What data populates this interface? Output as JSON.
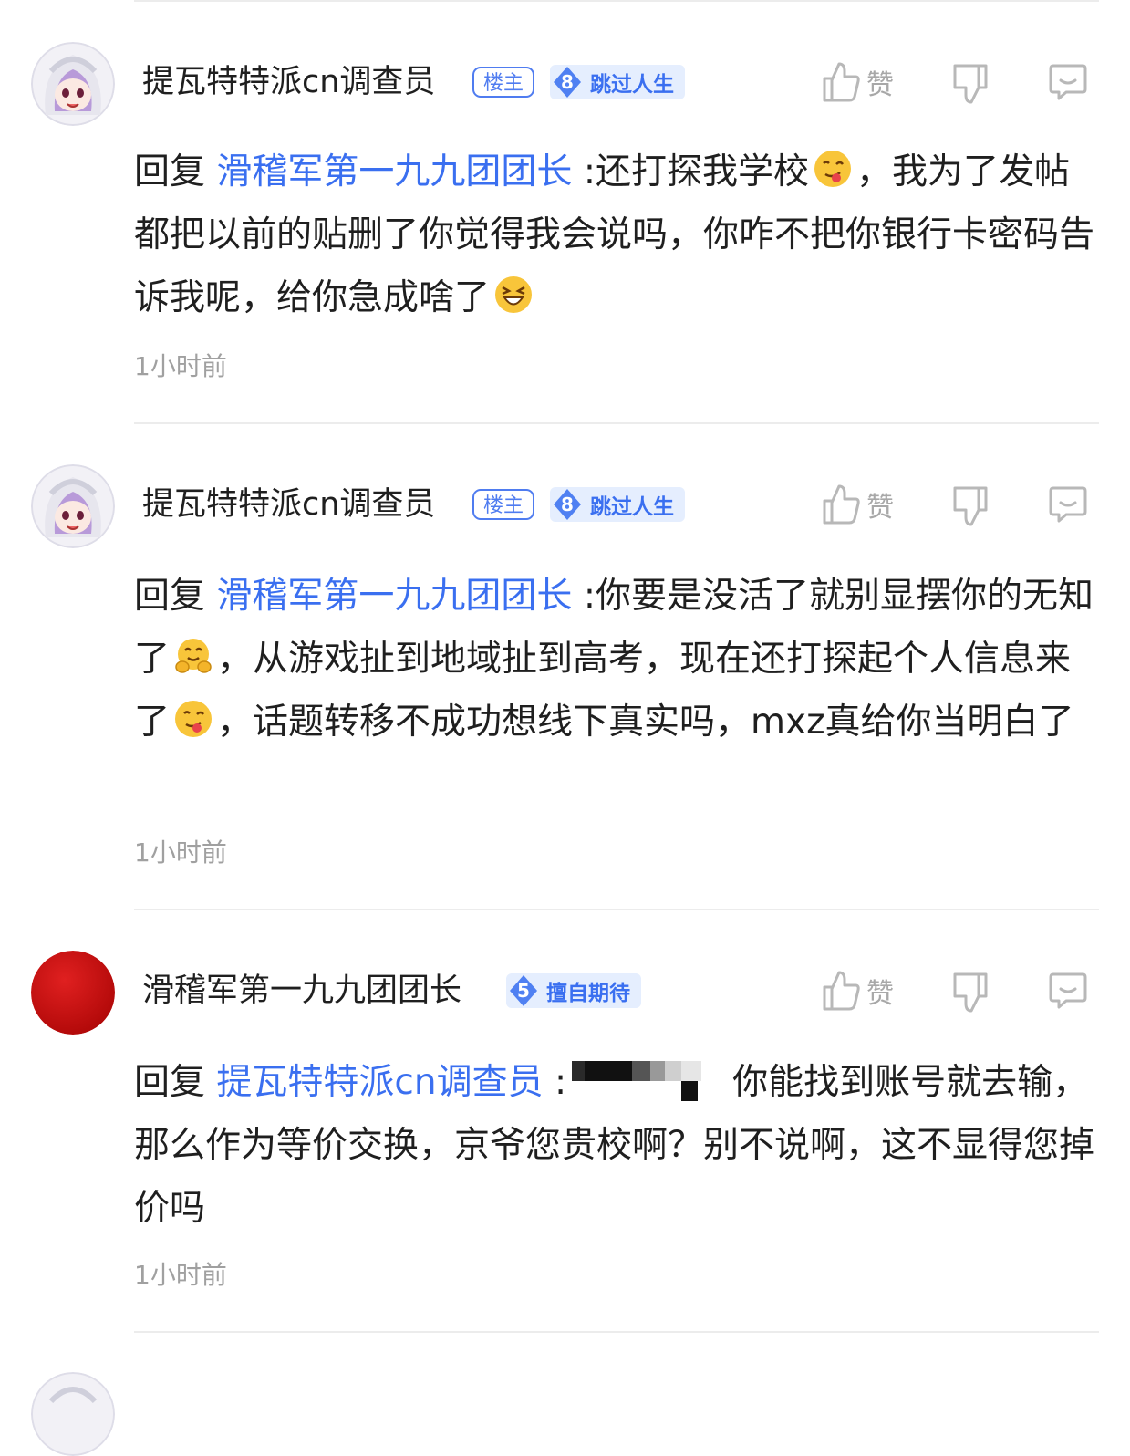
{
  "comments": [
    {
      "username": "提瓦特特派cn调查员",
      "owner_badge": "楼主",
      "level": "8",
      "level_title": "跳过人生",
      "like_label": "赞",
      "reply_prefix": "回复",
      "reply_target": "滑稽军第一九九团团长",
      "text_part1": ":还打探我学校",
      "text_part2": "，我为了发帖都把以前的贴删了你觉得我会说吗，你咋不把你银行卡密码告诉我呢，给你急成啥了",
      "time": "1小时前",
      "avatar": "anime-girl-avatar"
    },
    {
      "username": "提瓦特特派cn调查员",
      "owner_badge": "楼主",
      "level": "8",
      "level_title": "跳过人生",
      "like_label": "赞",
      "reply_prefix": "回复",
      "reply_target": "滑稽军第一九九团团长",
      "text_part1": ":你要是没活了就别显摆你的无知了",
      "text_part2": "，从游戏扯到地域扯到高考，现在还打探起个人信息来了",
      "text_part3": "，话题转移不成功想线下真实吗，mxz真给你当明白了",
      "time": "1小时前",
      "avatar": "anime-girl-avatar"
    },
    {
      "username": "滑稽军第一九九团团长",
      "level": "5",
      "level_title": "擅自期待",
      "like_label": "赞",
      "reply_prefix": "回复",
      "reply_target": "提瓦特特派cn调查员",
      "text_part1": ":",
      "text_part2": "你能找到账号就去输，那么作为等价交换，京爷您贵校啊？别不说啊，这不显得您掉价吗",
      "time": "1小时前",
      "avatar": "red-circle-avatar"
    }
  ],
  "colors": {
    "accent": "#3a6ff0",
    "level_badge_bg": "#e5eefe",
    "meta_gray": "#a0a0a0",
    "red_avatar": "#d01010"
  },
  "icons": [
    "thumbs-up-icon",
    "thumbs-down-icon",
    "comment-bubble-icon"
  ]
}
